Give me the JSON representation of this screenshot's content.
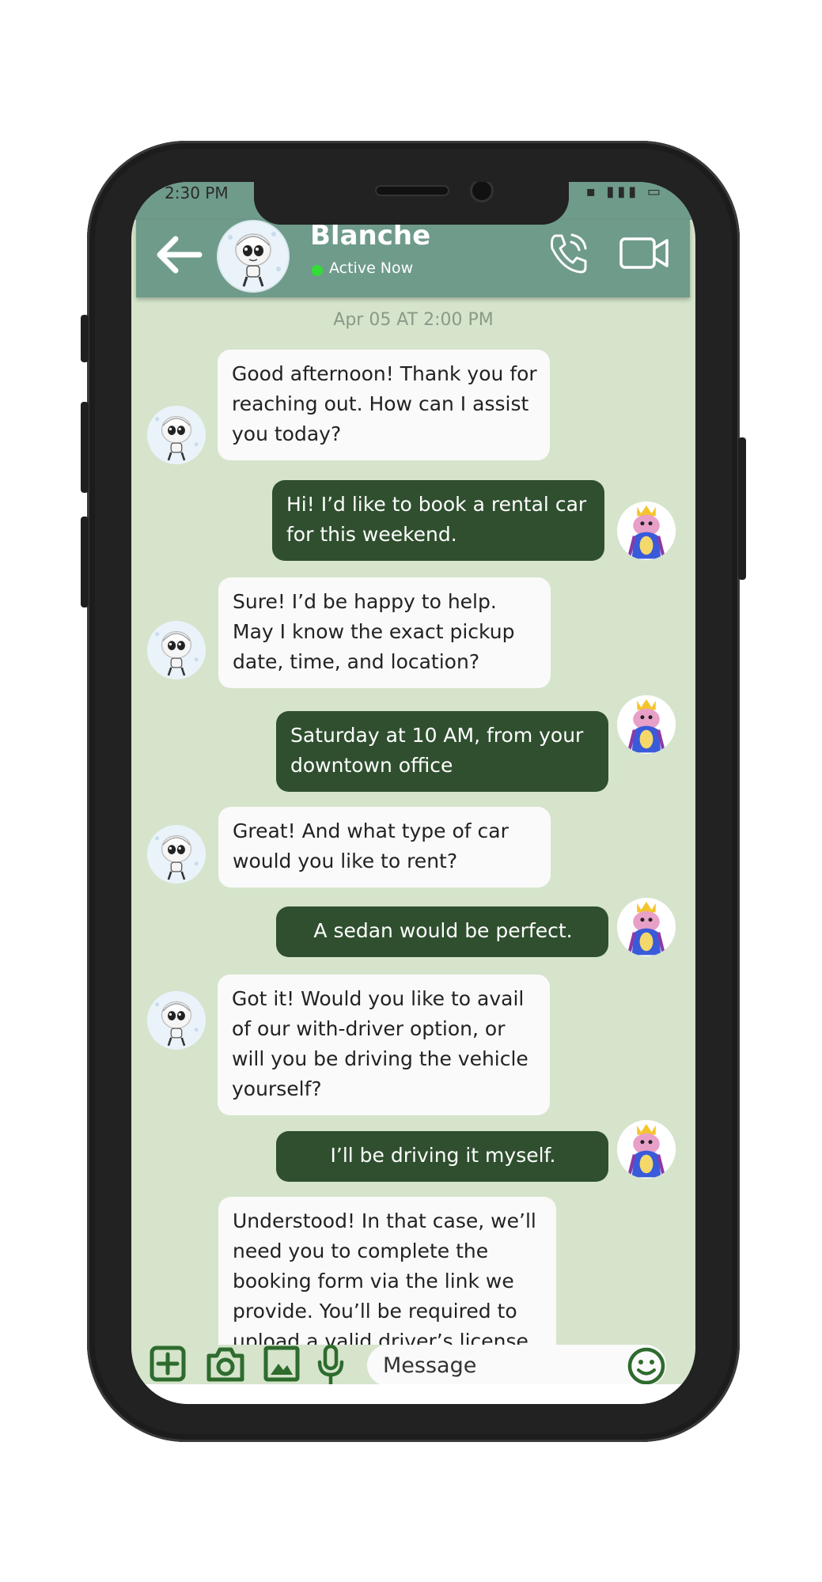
{
  "status_bar": {
    "time": "2:30 PM",
    "icons": "▪ ▮▮▮ ▭"
  },
  "header": {
    "contact_name": "Blanche",
    "status_text": "Active Now",
    "status_color": "#33dd33",
    "background": "#6f9b8b",
    "icons": [
      "back-arrow-icon",
      "phone-call-icon",
      "video-camera-icon"
    ]
  },
  "conversation": {
    "date_label": "Apr 05 AT 2:00 PM",
    "messages": [
      {
        "from": "Blanche",
        "text": "Good afternoon! Thank you for reaching out. How can I assist you today?"
      },
      {
        "from": "me",
        "text": "Hi! I’d like to book a rental car for this weekend."
      },
      {
        "from": "Blanche",
        "text": "Sure! I’d be happy to help. May I know the exact pickup date, time, and location?"
      },
      {
        "from": "me",
        "text": "Saturday at 10 AM, from your downtown office"
      },
      {
        "from": "Blanche",
        "text": "Great! And what type of car would you like to rent?"
      },
      {
        "from": "me",
        "text": "A sedan would be perfect."
      },
      {
        "from": "Blanche",
        "text": "Got it! Would you like to avail of our with-driver option, or will you be driving the vehicle yourself?"
      },
      {
        "from": "me",
        "text": "I’ll be driving it myself."
      },
      {
        "from": "Blanche",
        "text": "Understood! In that case, we’ll need you to complete the booking form via the link we provide. You’ll be required to upload a valid driver’s license"
      }
    ]
  },
  "composer": {
    "placeholder": "Message",
    "icons": [
      "add-icon",
      "camera-icon",
      "image-icon",
      "microphone-icon",
      "emoji-icon"
    ]
  },
  "colors": {
    "chat_background": "#d5e4cb",
    "incoming_bubble": "#fafafa",
    "outgoing_bubble": "#2f4f2f",
    "icon_green": "#2e6b2e"
  }
}
